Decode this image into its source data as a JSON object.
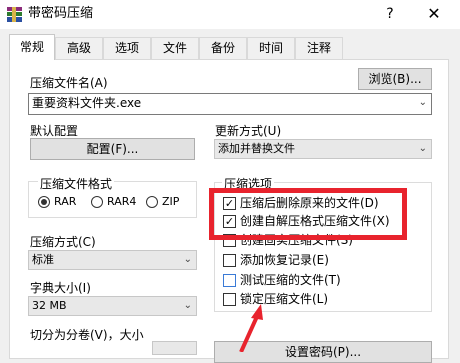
{
  "window": {
    "title": "带密码压缩",
    "help": "?",
    "close": "✕"
  },
  "tabs": [
    "常规",
    "高级",
    "选项",
    "文件",
    "备份",
    "时间",
    "注释"
  ],
  "archive_name": {
    "label": "压缩文件名(A)",
    "value": "重要资料文件夹.exe",
    "browse": "浏览(B)..."
  },
  "profile": {
    "label": "默认配置",
    "button": "配置(F)..."
  },
  "update_mode": {
    "label": "更新方式(U)",
    "value": "添加并替换文件"
  },
  "format": {
    "label": "压缩文件格式",
    "options": [
      "RAR",
      "RAR4",
      "ZIP"
    ],
    "selected": "RAR"
  },
  "method": {
    "label": "压缩方式(C)",
    "value": "标准"
  },
  "dict": {
    "label": "字典大小(I)",
    "value": "32 MB"
  },
  "split": {
    "label": "切分为分卷(V)，大小"
  },
  "options": {
    "label": "压缩选项",
    "items": [
      {
        "text": "压缩后删除原来的文件(D)",
        "checked": true
      },
      {
        "text": "创建自解压格式压缩文件(X)",
        "checked": true
      },
      {
        "text": "创建固实压缩文件(S)",
        "checked": false
      },
      {
        "text": "添加恢复记录(E)",
        "checked": false
      },
      {
        "text": "测试压缩的文件(T)",
        "checked": false
      },
      {
        "text": "锁定压缩文件(L)",
        "checked": false
      }
    ]
  },
  "password_button": "设置密码(P)...",
  "colors": {
    "highlight": "#e8232d",
    "arrow": "#e8232d"
  },
  "icons": {
    "app": "winrar-icon",
    "check": "checkmark-icon"
  }
}
